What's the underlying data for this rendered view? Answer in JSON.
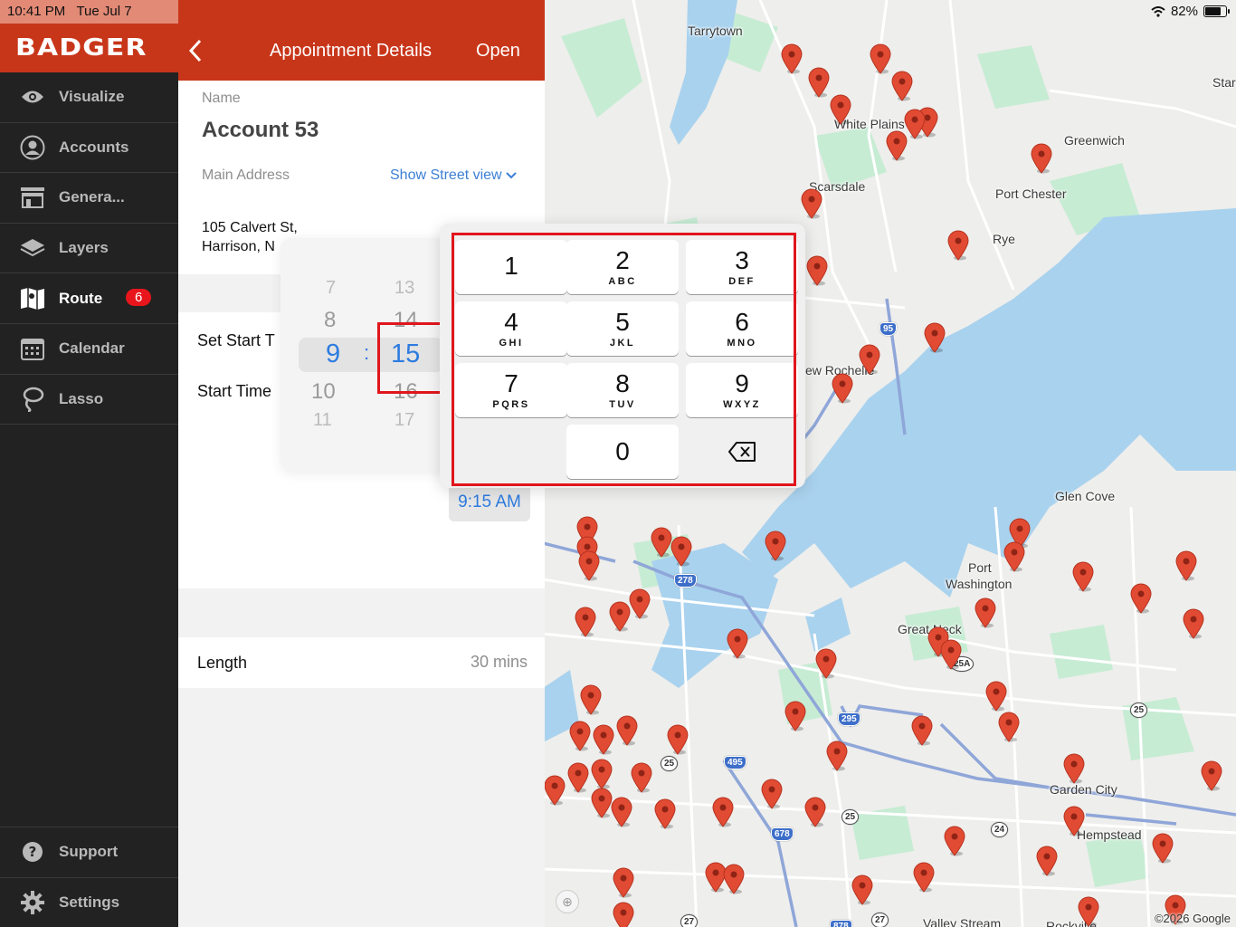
{
  "status_bar": {
    "time": "10:41 PM",
    "date": "Tue Jul 7",
    "battery": "82%",
    "battery_level": 0.82
  },
  "sidebar": {
    "logo": "BADGER",
    "items": [
      {
        "label": "Visualize",
        "icon": "eye-icon"
      },
      {
        "label": "Accounts",
        "icon": "person-icon"
      },
      {
        "label": "Genera...",
        "icon": "store-icon"
      },
      {
        "label": "Layers",
        "icon": "layers-icon"
      },
      {
        "label": "Route",
        "icon": "map-icon",
        "active": true,
        "badge": "6"
      },
      {
        "label": "Calendar",
        "icon": "calendar-icon"
      },
      {
        "label": "Lasso",
        "icon": "lasso-icon"
      }
    ],
    "bottom_items": [
      {
        "label": "Support",
        "icon": "question-icon"
      },
      {
        "label": "Settings",
        "icon": "gear-icon"
      }
    ]
  },
  "panel": {
    "title": "Appointment Details",
    "open_label": "Open",
    "name_label": "Name",
    "name_value": "Account 53",
    "address_label": "Main Address",
    "street_view_link": "Show Street view",
    "address_line1": "105 Calvert St,",
    "address_line2": "Harrison, N",
    "set_start_label": "Set Start T",
    "start_time_label": "Start Time",
    "start_time_value": "9:15 AM",
    "length_label": "Length",
    "length_value": "30 mins"
  },
  "time_picker": {
    "hours": [
      "7",
      "8",
      "9",
      "10",
      "11"
    ],
    "minutes": [
      "13",
      "14",
      "15",
      "16",
      "17"
    ],
    "separator": ":",
    "selected_hour": "9",
    "selected_minute": "15"
  },
  "keypad": {
    "keys": [
      {
        "digit": "1",
        "letters": ""
      },
      {
        "digit": "2",
        "letters": "ABC"
      },
      {
        "digit": "3",
        "letters": "DEF"
      },
      {
        "digit": "4",
        "letters": "GHI"
      },
      {
        "digit": "5",
        "letters": "JKL"
      },
      {
        "digit": "6",
        "letters": "MNO"
      },
      {
        "digit": "7",
        "letters": "PQRS"
      },
      {
        "digit": "8",
        "letters": "TUV"
      },
      {
        "digit": "9",
        "letters": "WXYZ"
      },
      {
        "digit": "0",
        "letters": ""
      }
    ],
    "delete_icon": "backspace-icon"
  },
  "map": {
    "places": [
      "Tarrytown",
      "White Plains",
      "Greenwich",
      "Scarsdale",
      "Port Chester",
      "Rye",
      "ew Rochelle",
      "Glen Cove",
      "Port",
      "Washington",
      "Great Neck",
      "Garden City",
      "Hempstead",
      "Valley Stream",
      "Rockville",
      "Star"
    ],
    "shields": [
      "95",
      "278",
      "25A",
      "295",
      "495",
      "25",
      "25",
      "678",
      "25",
      "24",
      "27",
      "27",
      "878"
    ],
    "copyright": "©2026 Google",
    "water_color": "#a9d2ee",
    "park_color": "#c7ecd4",
    "pin_color": "#e24b33"
  }
}
